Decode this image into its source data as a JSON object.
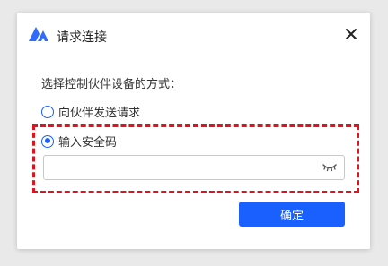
{
  "dialog": {
    "title": "请求连接",
    "logo_icon": "anydesk-style-logo-icon",
    "close_icon": "close-icon"
  },
  "prompt": "选择控制伙伴设备的方式：",
  "options": [
    {
      "label": "向伙伴发送请求",
      "checked": false
    },
    {
      "label": "输入安全码",
      "checked": true
    }
  ],
  "security_code": {
    "value": "",
    "placeholder": "",
    "toggle_icon": "eye-closed-icon"
  },
  "confirm_label": "确定",
  "colors": {
    "accent": "#1a5fff",
    "highlight_border": "#e0121e"
  }
}
